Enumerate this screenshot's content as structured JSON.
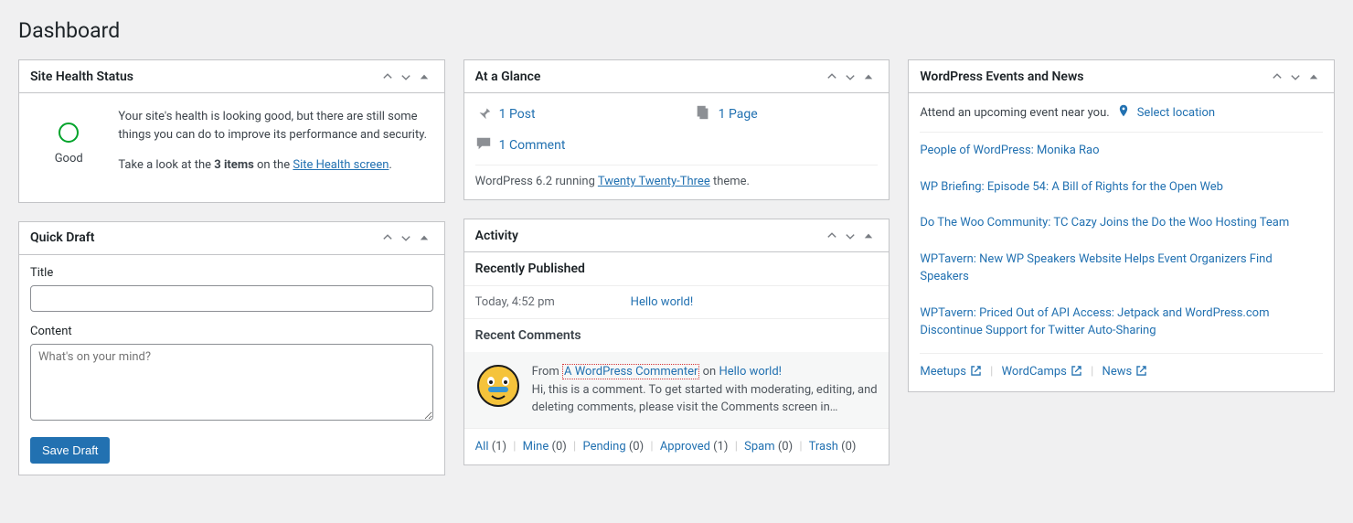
{
  "page_title": "Dashboard",
  "widgets": {
    "site_health": {
      "title": "Site Health Status",
      "status_label": "Good",
      "para1": "Your site's health is looking good, but there are still some things you can do to improve its performance and security.",
      "para2_pre": "Take a look at the ",
      "para2_bold": "3 items",
      "para2_mid": " on the ",
      "para2_link": "Site Health screen",
      "para2_post": "."
    },
    "quick_draft": {
      "title": "Quick Draft",
      "title_label": "Title",
      "content_label": "Content",
      "content_placeholder": "What's on your mind?",
      "save_label": "Save Draft"
    },
    "glance": {
      "title": "At a Glance",
      "post": "1 Post",
      "page": "1 Page",
      "comment": "1 Comment",
      "footer_pre": "WordPress 6.2 running ",
      "footer_link": "Twenty Twenty-Three",
      "footer_post": " theme."
    },
    "activity": {
      "title": "Activity",
      "recent_pub": "Recently Published",
      "time": "Today, 4:52 pm",
      "post_link": "Hello world!",
      "recent_com": "Recent Comments",
      "comment_from": "From ",
      "commenter": "A WordPress Commenter",
      "comment_on": " on ",
      "comment_post": "Hello world!",
      "comment_body": "Hi, this is a comment. To get started with moderating, editing, and deleting comments, please visit the Comments screen in…",
      "filters": {
        "all": "All",
        "all_n": "(1)",
        "mine": "Mine",
        "mine_n": "(0)",
        "pending": "Pending",
        "pending_n": "(0)",
        "approved": "Approved",
        "approved_n": "(1)",
        "spam": "Spam",
        "spam_n": "(0)",
        "trash": "Trash",
        "trash_n": "(0)"
      }
    },
    "news": {
      "title": "WordPress Events and News",
      "attend": "Attend an upcoming event near you.",
      "select_location": "Select location",
      "items": [
        "People of WordPress: Monika Rao",
        "WP Briefing: Episode 54: A Bill of Rights for the Open Web",
        "Do The Woo Community: TC Cazy Joins the Do the Woo Hosting Team",
        "WPTavern: New WP Speakers Website Helps Event Organizers Find Speakers",
        "WPTavern: Priced Out of API Access: Jetpack and WordPress.com Discontinue Support for Twitter Auto-Sharing"
      ],
      "footer": {
        "meetups": "Meetups",
        "wordcamps": "WordCamps",
        "news": "News"
      }
    }
  }
}
